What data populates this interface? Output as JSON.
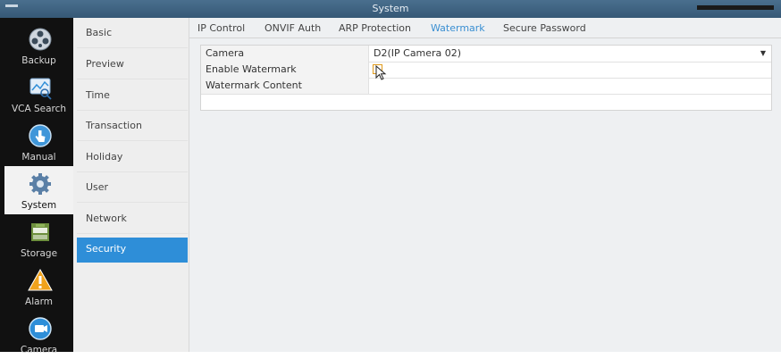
{
  "window": {
    "title": "System"
  },
  "modules": [
    {
      "label": "Backup",
      "icon": "backup-icon"
    },
    {
      "label": "VCA Search",
      "icon": "vca-search-icon"
    },
    {
      "label": "Manual",
      "icon": "manual-icon"
    },
    {
      "label": "System",
      "icon": "gear-icon",
      "active": true
    },
    {
      "label": "Storage",
      "icon": "storage-icon"
    },
    {
      "label": "Alarm",
      "icon": "alarm-icon"
    },
    {
      "label": "Camera",
      "icon": "camera-icon"
    }
  ],
  "submenu": {
    "items": [
      {
        "label": "Basic"
      },
      {
        "label": "Preview"
      },
      {
        "label": "Time"
      },
      {
        "label": "Transaction"
      },
      {
        "label": "Holiday"
      },
      {
        "label": "User"
      },
      {
        "label": "Network"
      },
      {
        "label": "Security",
        "active": true
      }
    ]
  },
  "tabs": [
    {
      "label": "IP Control"
    },
    {
      "label": "ONVIF Auth"
    },
    {
      "label": "ARP Protection"
    },
    {
      "label": "Watermark",
      "active": true
    },
    {
      "label": "Secure Password"
    }
  ],
  "form": {
    "camera_label": "Camera",
    "camera_value": "D2(IP Camera 02)",
    "enable_label": "Enable Watermark",
    "enable_checked": false,
    "content_label": "Watermark Content",
    "content_value": ""
  },
  "colors": {
    "active_blue": "#2e8ed8",
    "tab_active": "#3a8fd2",
    "checkbox_border": "#e09a1a"
  }
}
